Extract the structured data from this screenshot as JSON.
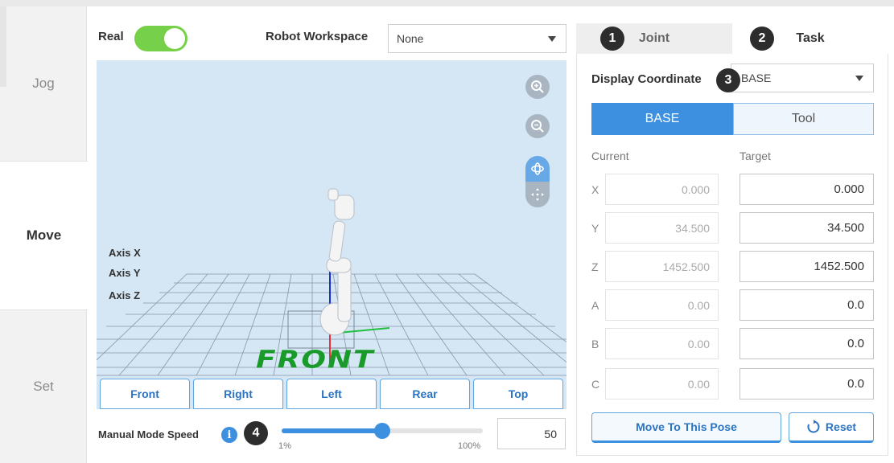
{
  "nav": {
    "items": [
      {
        "label": "Jog"
      },
      {
        "label": "Move"
      },
      {
        "label": "Set"
      }
    ]
  },
  "topbar": {
    "real_label": "Real",
    "real_on": true,
    "workspace_label": "Robot Workspace",
    "workspace_value": "None"
  },
  "viewport": {
    "axis_labels": [
      {
        "text": "Axis X",
        "color": "#e8323a"
      },
      {
        "text": "Axis Y",
        "color": "#2db84a"
      },
      {
        "text": "Axis Z",
        "color": "#3d8fe0"
      }
    ],
    "floor_text": "FRONT",
    "tools": [
      "zoom-in-icon",
      "zoom-out-icon",
      "rotate-icon",
      "pan-icon"
    ],
    "view_buttons": [
      "Front",
      "Right",
      "Left",
      "Rear",
      "Top"
    ]
  },
  "speed": {
    "label": "Manual Mode Speed",
    "min_label": "1%",
    "max_label": "100%",
    "value": "50",
    "percent": 50
  },
  "badges": [
    "1",
    "2",
    "3",
    "4"
  ],
  "panel": {
    "tabs": [
      {
        "label": "Joint",
        "active": false
      },
      {
        "label": "Task",
        "active": true
      }
    ],
    "display_coord_label": "Display Coordinate",
    "display_coord_value": "BASE",
    "segments": [
      {
        "label": "BASE",
        "active": true
      },
      {
        "label": "Tool",
        "active": false
      }
    ],
    "current_header": "Current",
    "target_header": "Target",
    "rows": [
      {
        "axis": "X",
        "current": "0.000",
        "target": "0.000"
      },
      {
        "axis": "Y",
        "current": "34.500",
        "target": "34.500"
      },
      {
        "axis": "Z",
        "current": "1452.500",
        "target": "1452.500"
      },
      {
        "axis": "A",
        "current": "0.00",
        "target": "0.0"
      },
      {
        "axis": "B",
        "current": "0.00",
        "target": "0.0"
      },
      {
        "axis": "C",
        "current": "0.00",
        "target": "0.0"
      }
    ],
    "move_button": "Move To This Pose",
    "reset_button": "Reset"
  },
  "colors": {
    "accent": "#3d8fe0",
    "toggle_on": "#77d04a",
    "viewport_bg": "#d5e6f5",
    "floor_text": "#1a9a2a"
  }
}
